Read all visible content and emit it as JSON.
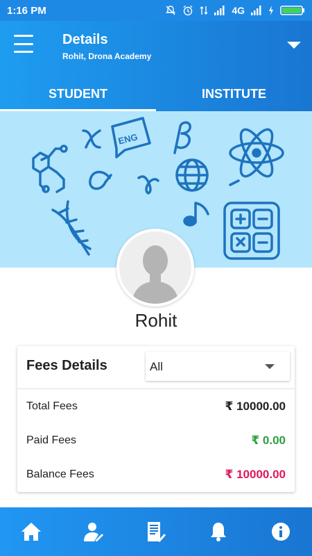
{
  "status_bar": {
    "time": "1:16 PM",
    "network": "4G",
    "icons": [
      "mute-icon",
      "alarm-icon",
      "data-arrows-icon",
      "signal-icon",
      "signal-icon",
      "charging-icon",
      "battery-icon"
    ]
  },
  "header": {
    "title": "Details",
    "subtitle": "Rohit, Drona Academy",
    "menu_icon": "hamburger-menu-icon",
    "dropdown_icon": "caret-down-icon"
  },
  "tabs": [
    {
      "label": "STUDENT",
      "active": true
    },
    {
      "label": "INSTITUTE",
      "active": false
    }
  ],
  "banner": {
    "background_color": "#b3e5fc",
    "icon_color": "#1e73be",
    "badge_text": "ENG",
    "symbols": [
      "x",
      "ENG",
      "β",
      "atom",
      "molecule",
      "α",
      "globe",
      "γ",
      "music-note",
      "dna",
      "calculator",
      "-"
    ]
  },
  "profile": {
    "name": "Rohit",
    "avatar_icon": "person-silhouette-icon"
  },
  "fees": {
    "title": "Fees Details",
    "filter_selected": "All",
    "rows": [
      {
        "label": "Total Fees",
        "amount": "₹ 10000.00",
        "color": "#212121"
      },
      {
        "label": "Paid Fees",
        "amount": "₹ 0.00",
        "color": "#2e9e3e"
      },
      {
        "label": "Balance Fees",
        "amount": "₹ 10000.00",
        "color": "#e0185a"
      }
    ]
  },
  "bottom_nav": [
    {
      "icon": "home-icon"
    },
    {
      "icon": "student-profile-icon"
    },
    {
      "icon": "report-icon"
    },
    {
      "icon": "notification-bell-icon"
    },
    {
      "icon": "info-icon"
    }
  ],
  "colors": {
    "primary": "#1e88e5",
    "primary_dark": "#1976d2",
    "paid_green": "#2e9e3e",
    "balance_pink": "#e0185a"
  }
}
